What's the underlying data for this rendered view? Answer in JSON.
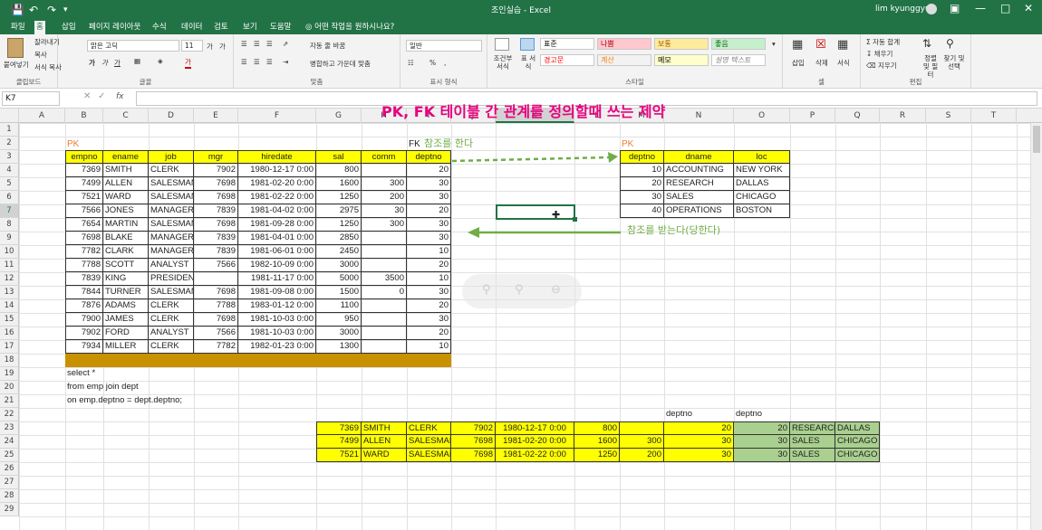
{
  "window": {
    "title": "조인실습 - Excel",
    "user": "lim kyunggyun"
  },
  "tabs": [
    "파일",
    "홈",
    "삽입",
    "페이지 레이아웃",
    "수식",
    "데이터",
    "검토",
    "보기",
    "도움말"
  ],
  "tell_me": "어떤 작업을 원하시나요?",
  "ribbon": {
    "clipboard": {
      "paste": "붙여넣기",
      "cut": "잘라내기",
      "copy": "복사",
      "format_painter": "서식 복사",
      "label": "클립보드"
    },
    "font": {
      "name": "맑은 고딕",
      "size": "11",
      "bold": "가",
      "italic": "가",
      "underline": "가",
      "label": "글꼴"
    },
    "alignment": {
      "wrap": "자동 줄 바꿈",
      "merge": "병합하고 가운데 맞춤",
      "label": "맞춤"
    },
    "number": {
      "format": "일반",
      "percent": "%",
      "comma": ",",
      "label": "표시 형식"
    },
    "styles": {
      "conditional": "조건부 서식",
      "table": "표 서식",
      "cells": [
        {
          "text": "표준",
          "bg": "#ffffff",
          "fg": "#000000"
        },
        {
          "text": "나쁨",
          "bg": "#ffc7ce",
          "fg": "#9c0006"
        },
        {
          "text": "보통",
          "bg": "#ffeb9c",
          "fg": "#9c5700"
        },
        {
          "text": "좋음",
          "bg": "#c6efce",
          "fg": "#006100"
        },
        {
          "text": "경고문",
          "bg": "#ffffff",
          "fg": "#ff0000"
        },
        {
          "text": "계산",
          "bg": "#f2f2f2",
          "fg": "#fa7d00"
        },
        {
          "text": "메모",
          "bg": "#ffffcc",
          "fg": "#000000"
        },
        {
          "text": "설명 텍스트",
          "bg": "#ffffff",
          "fg": "#7f7f7f"
        }
      ],
      "label": "스타일"
    },
    "cells_group": {
      "insert": "삽입",
      "delete": "삭제",
      "format": "서식",
      "label": "셀"
    },
    "editing": {
      "autosum": "자동 합계",
      "fill": "채우기",
      "clear": "지우기",
      "sort": "정렬 및 필터",
      "find": "찾기 및 선택",
      "label": "편집"
    }
  },
  "formula_bar": {
    "name_box": "K7",
    "fx": "fx",
    "content": ""
  },
  "columns": [
    "A",
    "B",
    "C",
    "D",
    "E",
    "F",
    "G",
    "H",
    "I",
    "J",
    "K",
    "L",
    "M",
    "N",
    "O",
    "P",
    "Q",
    "R",
    "S",
    "T"
  ],
  "rows": [
    "1",
    "2",
    "3",
    "4",
    "5",
    "6",
    "7",
    "8",
    "9",
    "10",
    "11",
    "12",
    "13",
    "14",
    "15",
    "16",
    "17",
    "18",
    "19",
    "20",
    "21",
    "22",
    "23",
    "24",
    "25",
    "26",
    "27",
    "28",
    "29"
  ],
  "annotations": {
    "title": "PK, FK 테이블 간 관계를 정의할때 쓰는 제약",
    "pk_left": "PK",
    "fk": "FK",
    "pk_right": "PK",
    "refers": "참조를 한다",
    "referenced": "참조를 받는다(당한다)"
  },
  "emp": {
    "headers": [
      "empno",
      "ename",
      "job",
      "mgr",
      "hiredate",
      "sal",
      "comm",
      "deptno"
    ],
    "rows": [
      [
        "7369",
        "SMITH",
        "CLERK",
        "7902",
        "1980-12-17 0:00",
        "800",
        "",
        "20"
      ],
      [
        "7499",
        "ALLEN",
        "SALESMAN",
        "7698",
        "1981-02-20 0:00",
        "1600",
        "300",
        "30"
      ],
      [
        "7521",
        "WARD",
        "SALESMAN",
        "7698",
        "1981-02-22 0:00",
        "1250",
        "200",
        "30"
      ],
      [
        "7566",
        "JONES",
        "MANAGER",
        "7839",
        "1981-04-02 0:00",
        "2975",
        "30",
        "20"
      ],
      [
        "7654",
        "MARTIN",
        "SALESMAN",
        "7698",
        "1981-09-28 0:00",
        "1250",
        "300",
        "30"
      ],
      [
        "7698",
        "BLAKE",
        "MANAGER",
        "7839",
        "1981-04-01 0:00",
        "2850",
        "",
        "30"
      ],
      [
        "7782",
        "CLARK",
        "MANAGER",
        "7839",
        "1981-06-01 0:00",
        "2450",
        "",
        "10"
      ],
      [
        "7788",
        "SCOTT",
        "ANALYST",
        "7566",
        "1982-10-09 0:00",
        "3000",
        "",
        "20"
      ],
      [
        "7839",
        "KING",
        "PRESIDENT",
        "",
        "1981-11-17 0:00",
        "5000",
        "3500",
        "10"
      ],
      [
        "7844",
        "TURNER",
        "SALESMAN",
        "7698",
        "1981-09-08 0:00",
        "1500",
        "0",
        "30"
      ],
      [
        "7876",
        "ADAMS",
        "CLERK",
        "7788",
        "1983-01-12 0:00",
        "1100",
        "",
        "20"
      ],
      [
        "7900",
        "JAMES",
        "CLERK",
        "7698",
        "1981-10-03 0:00",
        "950",
        "",
        "30"
      ],
      [
        "7902",
        "FORD",
        "ANALYST",
        "7566",
        "1981-10-03 0:00",
        "3000",
        "",
        "20"
      ],
      [
        "7934",
        "MILLER",
        "CLERK",
        "7782",
        "1982-01-23 0:00",
        "1300",
        "",
        "10"
      ]
    ]
  },
  "dept": {
    "headers": [
      "deptno",
      "dname",
      "loc"
    ],
    "rows": [
      [
        "10",
        "ACCOUNTING",
        "NEW YORK"
      ],
      [
        "20",
        "RESEARCH",
        "DALLAS"
      ],
      [
        "30",
        "SALES",
        "CHICAGO"
      ],
      [
        "40",
        "OPERATIONS",
        "BOSTON"
      ]
    ]
  },
  "sql": [
    "select *",
    "from emp join dept",
    "on emp.deptno = dept.deptno;"
  ],
  "result": {
    "labels": [
      "deptno",
      "deptno"
    ],
    "rows": [
      [
        "7369",
        "SMITH",
        "CLERK",
        "7902",
        "1980-12-17 0:00",
        "800",
        "",
        "20",
        "20",
        "RESEARCH",
        "DALLAS"
      ],
      [
        "7499",
        "ALLEN",
        "SALESMAN",
        "7698",
        "1981-02-20 0:00",
        "1600",
        "300",
        "30",
        "30",
        "SALES",
        "CHICAGO"
      ],
      [
        "7521",
        "WARD",
        "SALESMAN",
        "7698",
        "1981-02-22 0:00",
        "1250",
        "200",
        "30",
        "30",
        "SALES",
        "CHICAGO"
      ]
    ]
  },
  "colors": {
    "brand": "#217346",
    "title_text": "#e6007e",
    "pk_text": "#ed7d31",
    "arrow": "#70ad47",
    "note_text": "#70ad47",
    "header_fill": "#ffff00",
    "separator_fill": "#c89100",
    "join_fill": "#a9d08e"
  }
}
